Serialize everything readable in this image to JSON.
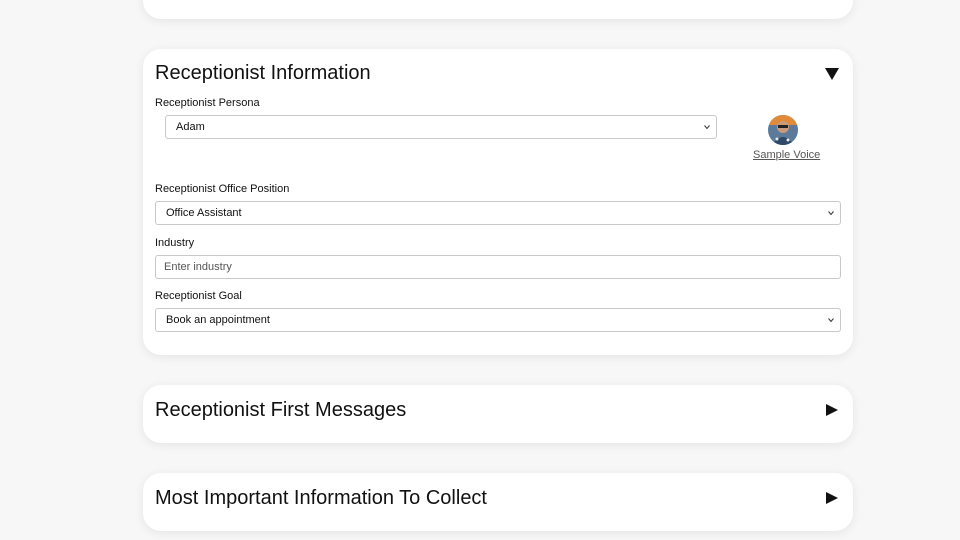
{
  "receptionist_info": {
    "title": "Receptionist Information",
    "toggle_icon": "triangle-down-icon",
    "persona": {
      "label": "Receptionist Persona",
      "value": "Adam",
      "sample_voice_label": "Sample Voice",
      "avatar_icon": "persona-avatar"
    },
    "office_position": {
      "label": "Receptionist Office Position",
      "value": "Office Assistant"
    },
    "industry": {
      "label": "Industry",
      "placeholder": "Enter industry",
      "value": ""
    },
    "goal": {
      "label": "Receptionist Goal",
      "value": "Book an appointment"
    }
  },
  "first_messages": {
    "title": "Receptionist First Messages",
    "toggle_icon": "triangle-right-icon"
  },
  "important_info": {
    "title": "Most Important Information To Collect",
    "toggle_icon": "triangle-right-icon"
  },
  "colors": {
    "page_background": "#f7f7f7",
    "card_background": "#ffffff",
    "border": "#c9c9c9",
    "text": "#111111",
    "link": "#555555"
  }
}
